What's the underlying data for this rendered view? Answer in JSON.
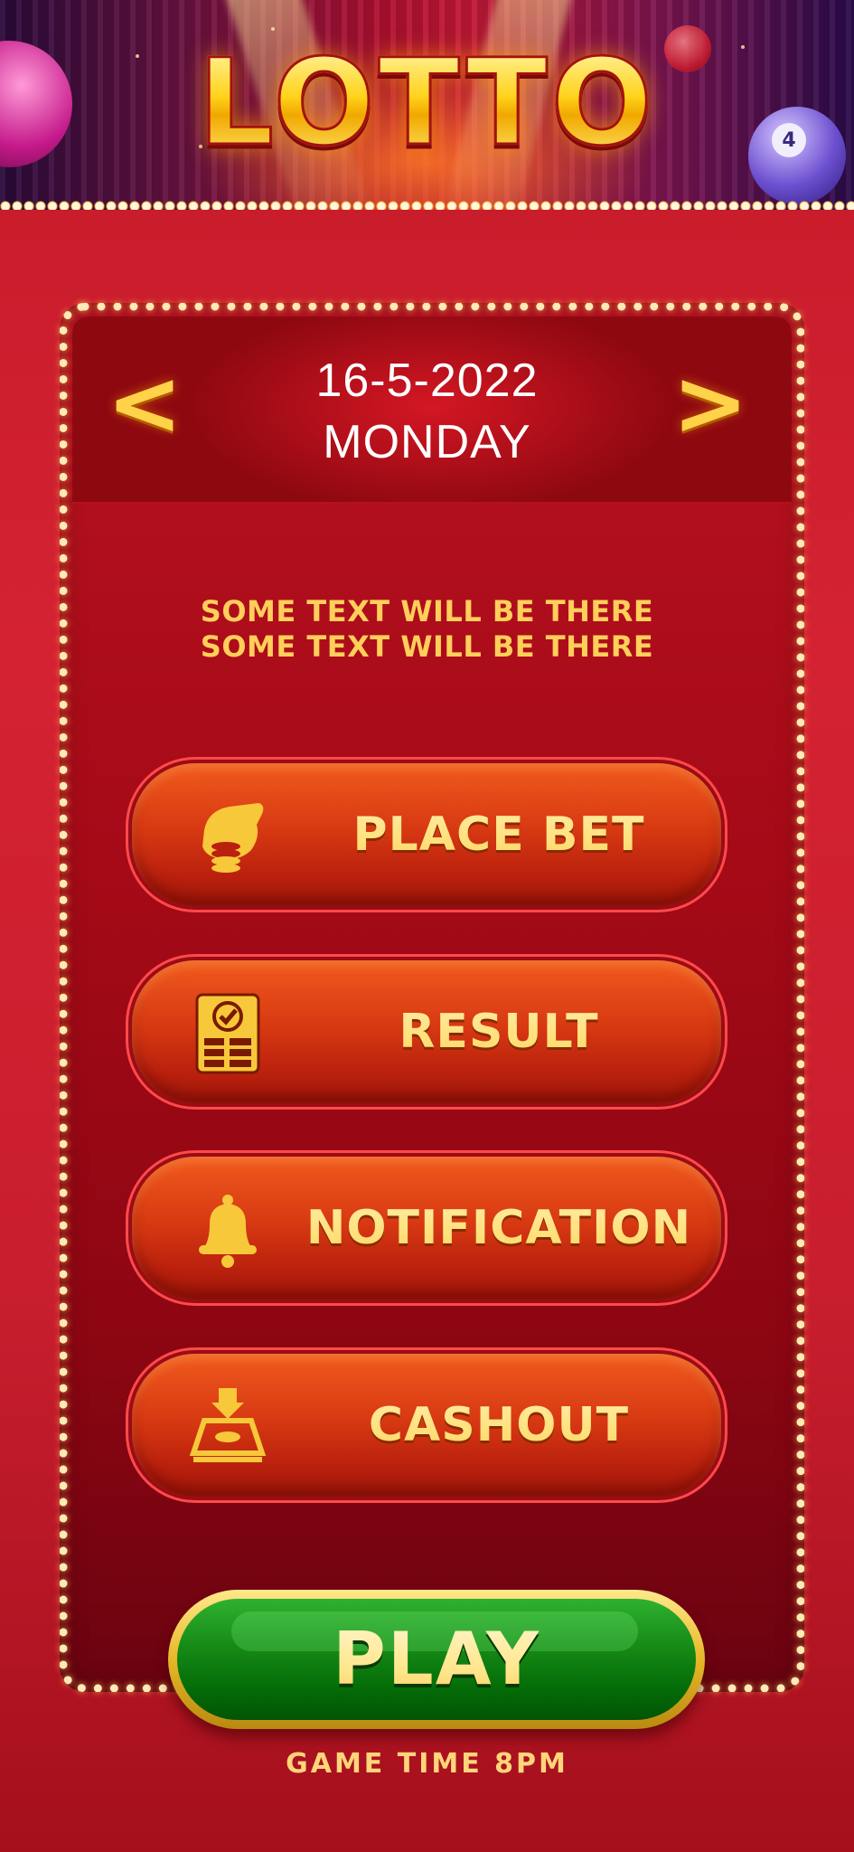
{
  "header": {
    "title": "LOTTO",
    "ball_number": "4"
  },
  "date_selector": {
    "prev_symbol": "<",
    "next_symbol": ">",
    "date": "16-5-2022",
    "day": "MONDAY"
  },
  "info_text": {
    "line1": "SOME TEXT WILL BE THERE",
    "line2": "SOME TEXT WILL BE THERE"
  },
  "menu": [
    {
      "label": "PLACE BET",
      "icon": "hand-coins-icon"
    },
    {
      "label": "RESULT",
      "icon": "result-sheet-icon"
    },
    {
      "label": "NOTIFICATION",
      "icon": "bell-icon"
    },
    {
      "label": "CASHOUT",
      "icon": "cashout-tray-icon"
    }
  ],
  "play": {
    "label": "PLAY",
    "game_time": "GAME TIME 8PM"
  },
  "colors": {
    "background": "#c41a2a",
    "panel": "#a60a17",
    "gold": "#ffd24a",
    "button_orange": "#d83a12",
    "play_green": "#158a16"
  }
}
